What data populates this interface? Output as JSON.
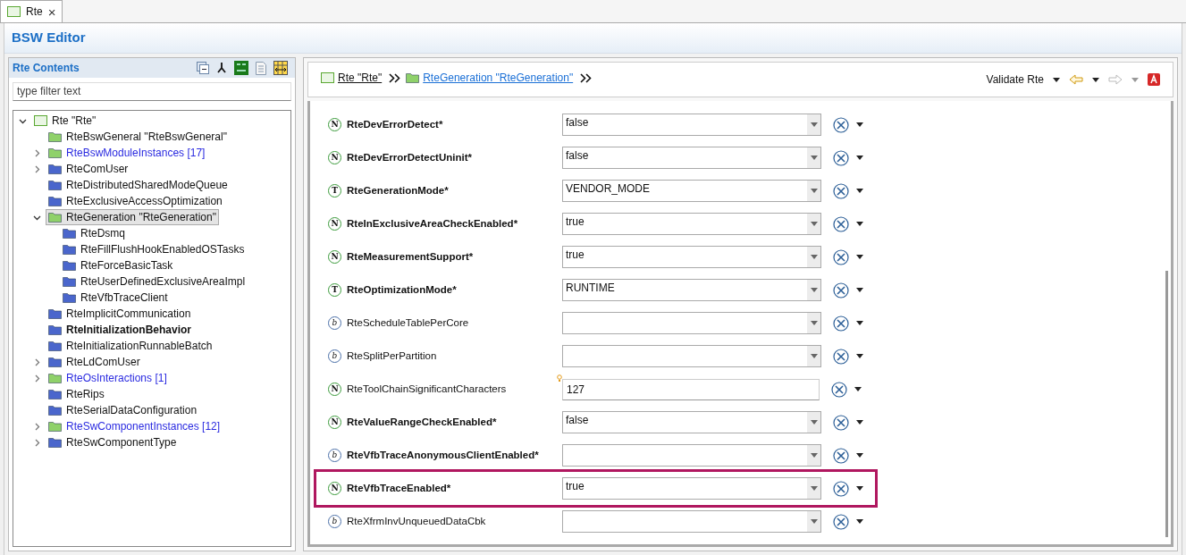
{
  "tab": {
    "label": "Rte",
    "selected": true,
    "close": "×"
  },
  "editor_title": "BSW Editor",
  "contents": {
    "title": "Rte Contents",
    "filter": {
      "placeholder": "type filter text"
    },
    "tree": [
      {
        "label": "Rte \"Rte\"",
        "kind": "module",
        "expanded": true,
        "selected": false,
        "children": [
          {
            "label": "RteBswGeneral \"RteBswGeneral\"",
            "color": "#8fd16a",
            "kind": "plain",
            "selected": false
          },
          {
            "label": "RteBswModuleInstances [17]",
            "color": "#8fd16a",
            "kind": "link",
            "expanded": false,
            "selected": false
          },
          {
            "label": "RteComUser",
            "color": "#4a66cc",
            "kind": "plain",
            "expanded": false,
            "selected": false
          },
          {
            "label": "RteDistributedSharedModeQueue",
            "color": "#4a66cc",
            "kind": "plain",
            "selected": false
          },
          {
            "label": "RteExclusiveAccessOptimization",
            "color": "#4a66cc",
            "kind": "plain",
            "selected": false
          },
          {
            "label": "RteGeneration \"RteGeneration\"",
            "color": "#8fd16a",
            "kind": "plain",
            "expanded": true,
            "selected": true,
            "children": [
              {
                "label": "RteDsmq",
                "color": "#4a66cc",
                "kind": "plain",
                "selected": false
              },
              {
                "label": "RteFillFlushHookEnabledOSTasks",
                "color": "#4a66cc",
                "kind": "plain",
                "selected": false
              },
              {
                "label": "RteForceBasicTask",
                "color": "#4a66cc",
                "kind": "plain",
                "selected": false
              },
              {
                "label": "RteUserDefinedExclusiveAreaImpl",
                "color": "#4a66cc",
                "kind": "plain",
                "selected": false
              },
              {
                "label": "RteVfbTraceClient",
                "color": "#4a66cc",
                "kind": "plain",
                "selected": false
              }
            ]
          },
          {
            "label": "RteImplicitCommunication",
            "color": "#4a66cc",
            "kind": "plain",
            "selected": false
          },
          {
            "label": "RteInitializationBehavior",
            "color": "#4a66cc",
            "kind": "bold",
            "selected": false
          },
          {
            "label": "RteInitializationRunnableBatch",
            "color": "#4a66cc",
            "kind": "plain",
            "selected": false
          },
          {
            "label": "RteLdComUser",
            "color": "#4a66cc",
            "kind": "plain",
            "expanded": false,
            "selected": false
          },
          {
            "label": "RteOsInteractions [1]",
            "color": "#8fd16a",
            "kind": "link",
            "expanded": false,
            "selected": false
          },
          {
            "label": "RteRips",
            "color": "#4a66cc",
            "kind": "plain",
            "selected": false
          },
          {
            "label": "RteSerialDataConfiguration",
            "color": "#4a66cc",
            "kind": "plain",
            "selected": false
          },
          {
            "label": "RteSwComponentInstances [12]",
            "color": "#8fd16a",
            "kind": "link",
            "expanded": false,
            "selected": false
          },
          {
            "label": "RteSwComponentType",
            "color": "#4a66cc",
            "kind": "plain",
            "expanded": false,
            "selected": false
          }
        ]
      }
    ]
  },
  "breadcrumb": [
    {
      "label": "Rte \"Rte\"",
      "kind": "module"
    },
    {
      "label": "RteGeneration \"RteGeneration\"",
      "kind": "folder",
      "color": "#8fd16a"
    }
  ],
  "toolbar": {
    "validate": "Validate Rte"
  },
  "parameters": [
    {
      "name": "RteDevErrorDetect*",
      "badge": "N",
      "kind": "dropdown",
      "value": "false",
      "required": true,
      "highlighted": false
    },
    {
      "name": "RteDevErrorDetectUninit*",
      "badge": "N",
      "kind": "dropdown",
      "value": "false",
      "required": true,
      "highlighted": false
    },
    {
      "name": "RteGenerationMode*",
      "badge": "T",
      "kind": "dropdown",
      "value": "VENDOR_MODE",
      "required": true,
      "highlighted": false
    },
    {
      "name": "RteInExclusiveAreaCheckEnabled*",
      "badge": "N",
      "kind": "dropdown",
      "value": "true",
      "required": true,
      "highlighted": false
    },
    {
      "name": "RteMeasurementSupport*",
      "badge": "N",
      "kind": "dropdown",
      "value": "true",
      "required": true,
      "highlighted": false
    },
    {
      "name": "RteOptimizationMode*",
      "badge": "T",
      "kind": "dropdown",
      "value": "RUNTIME",
      "required": true,
      "highlighted": false
    },
    {
      "name": "RteScheduleTablePerCore",
      "badge": "b",
      "kind": "dropdown",
      "required": false,
      "highlighted": false
    },
    {
      "name": "RteSplitPerPartition",
      "badge": "b",
      "kind": "dropdown",
      "required": false,
      "highlighted": false
    },
    {
      "name": "RteToolChainSignificantCharacters",
      "badge": "N",
      "kind": "text",
      "value": "127",
      "required": false,
      "highlighted": false,
      "hint": true
    },
    {
      "name": "RteValueRangeCheckEnabled*",
      "badge": "N",
      "kind": "dropdown",
      "value": "false",
      "required": true,
      "highlighted": false
    },
    {
      "name": "RteVfbTraceAnonymousClientEnabled*",
      "badge": "b",
      "kind": "dropdown",
      "required": true,
      "highlighted": false
    },
    {
      "name": "RteVfbTraceEnabled*",
      "badge": "N",
      "kind": "dropdown",
      "value": "true",
      "required": true,
      "highlighted": true
    },
    {
      "name": "RteXfrmInvUnqueuedDataCbk",
      "badge": "b",
      "kind": "dropdown",
      "required": false,
      "highlighted": false
    }
  ]
}
